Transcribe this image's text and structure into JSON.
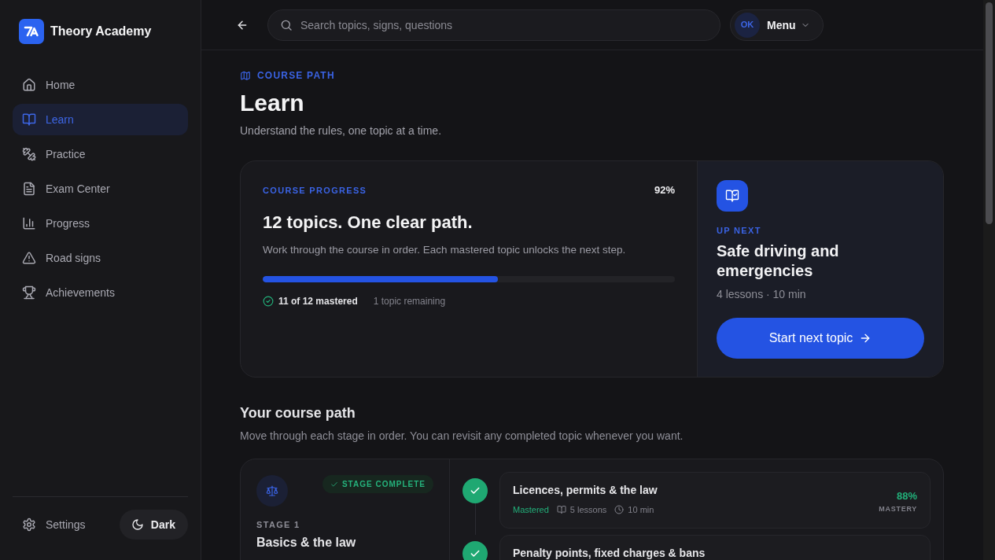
{
  "sidebar": {
    "brand": {
      "name": "Theory Academy"
    },
    "nav_items": [
      {
        "label": "Home",
        "selected": false
      },
      {
        "label": "Learn",
        "selected": true
      },
      {
        "label": "Practice",
        "selected": false
      },
      {
        "label": "Exam Center",
        "selected": false
      },
      {
        "label": "Progress",
        "selected": false
      },
      {
        "label": "Road signs",
        "selected": false
      },
      {
        "label": "Achievements",
        "selected": false
      }
    ],
    "footer": {
      "settings": {
        "label": "Settings"
      },
      "theme_toggle": {
        "label": "Dark"
      }
    }
  },
  "top_bar": {
    "search": {
      "placeholder": "Search topics, signs, questions"
    },
    "account_menu": {
      "initials": "OK",
      "label": "Menu"
    }
  },
  "page_header": {
    "eyebrow": "COURSE PATH",
    "title": "Learn",
    "subtitle": "Understand the rules, one topic at a time."
  },
  "course_progress": {
    "eyebrow": "COURSE PROGRESS",
    "percent": "92%",
    "title": "12 topics. One clear path.",
    "description": "Work through the course in order. Each mastered topic unlocks the next step.",
    "level": 0.57,
    "mastered": "11 of 12 mastered",
    "remaining": "1 topic remaining"
  },
  "up_next": {
    "eyebrow": "UP NEXT",
    "title": "Safe driving and emergencies",
    "meta": "4 lessons · 10 min",
    "button": "Start next topic"
  },
  "course_path": {
    "title": "Your course path",
    "subtitle": "Move through each stage in order. You can revisit any completed topic whenever you want.",
    "stages": [
      {
        "label": "STAGE 1",
        "title": "Basics & the law",
        "complete": true,
        "badge": "STAGE COMPLETE",
        "topics": [
          {
            "title": "Licences, permits & the law",
            "mastered": true,
            "status": "Mastered",
            "lessons": "5 lessons",
            "duration": "10 min",
            "mastery": "88%",
            "mastery_label": "MASTERY"
          },
          {
            "title": "Penalty points, fixed charges & bans",
            "mastered": true
          }
        ]
      }
    ]
  }
}
